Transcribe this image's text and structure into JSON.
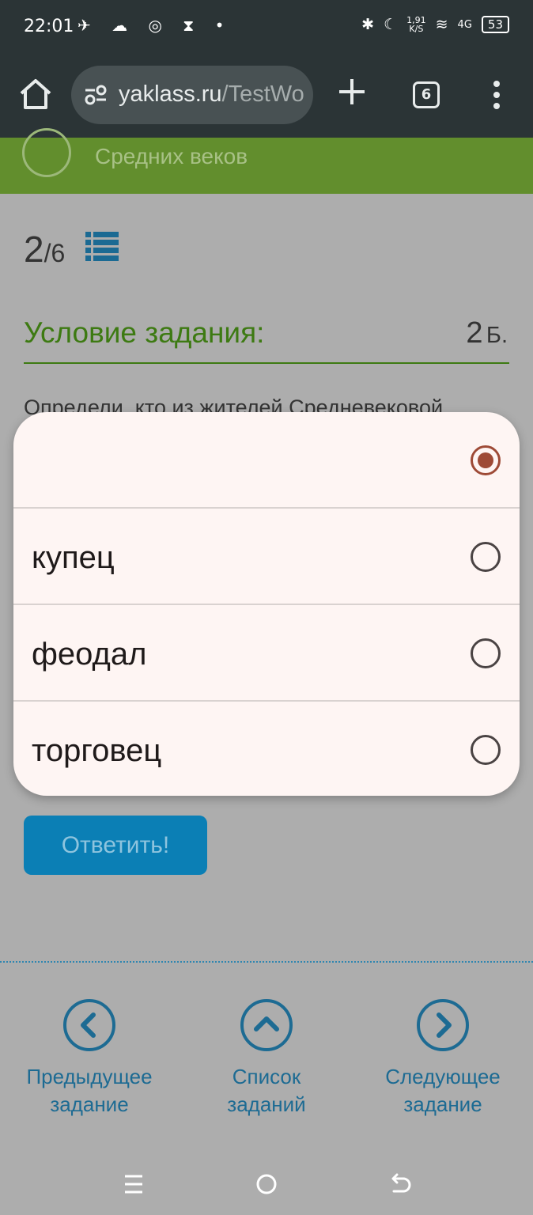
{
  "status": {
    "time": "22:01",
    "left_icons": "✈ ☁ ◎ ⧗ •",
    "net_speed_top": "1,91",
    "net_speed_unit": "K/S",
    "network": "4G",
    "battery": "53"
  },
  "browser": {
    "url_domain": "yaklass.ru",
    "url_path": "/TestWo",
    "tab_count": "6"
  },
  "course": {
    "title": "Средних веков"
  },
  "task": {
    "current": "2",
    "total": "/6",
    "condition_title": "Условие задания:",
    "points": "2",
    "points_unit": "Б.",
    "question": "Определи, кто из жителей Средневековой",
    "answer_button": "Ответить!"
  },
  "dropdown": {
    "options": [
      {
        "label": "",
        "selected": true
      },
      {
        "label": "купец",
        "selected": false
      },
      {
        "label": "феодал",
        "selected": false
      },
      {
        "label": "торговец",
        "selected": false
      }
    ]
  },
  "bottom_nav": {
    "prev_line1": "Предыдущее",
    "prev_line2": "задание",
    "list_line1": "Список",
    "list_line2": "заданий",
    "next_line1": "Следующее",
    "next_line2": "задание"
  },
  "colors": {
    "accent_green": "#3d7a12",
    "accent_blue": "#1d6b93",
    "radio_selected": "#9e4a36"
  }
}
